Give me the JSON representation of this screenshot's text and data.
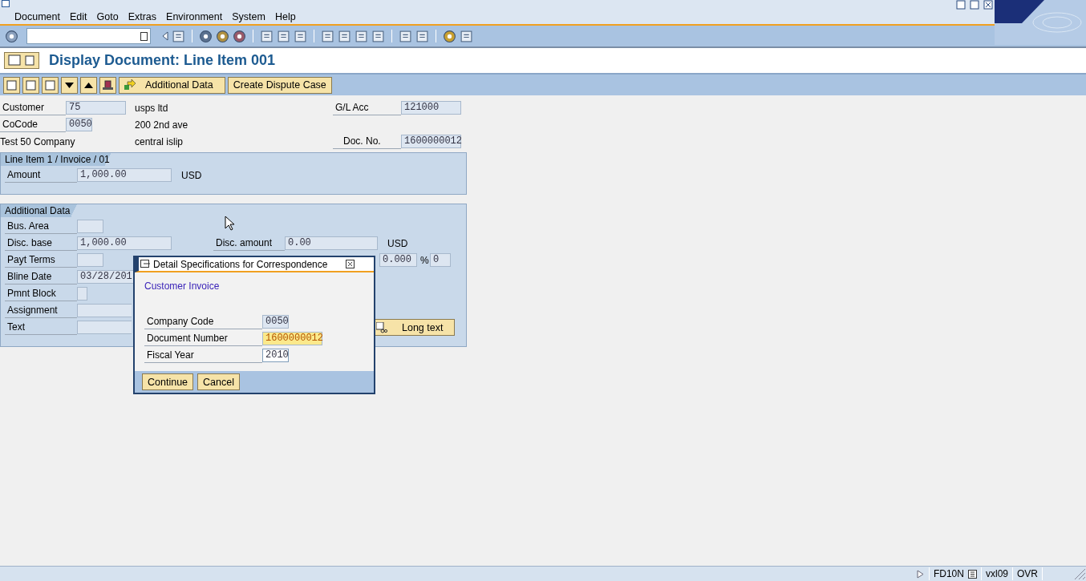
{
  "menu": [
    "Document",
    "Edit",
    "Goto",
    "Extras",
    "Environment",
    "System",
    "Help"
  ],
  "title": "Display Document: Line Item 001",
  "app_toolbar": {
    "buttons": [
      "Additional Data",
      "Create Dispute Case"
    ]
  },
  "header": {
    "customer_label": "Customer",
    "customer": "75",
    "name": "usps ltd",
    "gl_label": "G/L Acc",
    "gl": "121000",
    "cocode_label": "CoCode",
    "cocode": "0050",
    "street": "200 2nd ave",
    "company": "Test 50 Company",
    "city": "central islip",
    "docno_label": "Doc. No.",
    "docno": "1600000012"
  },
  "line_item": {
    "title": "Line Item 1 / Invoice / 01",
    "amount_label": "Amount",
    "amount": "1,000.00",
    "currency": "USD"
  },
  "additional_data": {
    "title": "Additional Data",
    "rows": [
      {
        "label": "Bus. Area",
        "value": ""
      },
      {
        "label": "Disc. base",
        "value": "1,000.00"
      },
      {
        "label": "Payt Terms",
        "value": ""
      },
      {
        "label": "Bline Date",
        "value": "03/28/201"
      },
      {
        "label": "Pmnt Block",
        "value": ""
      },
      {
        "label": "Assignment",
        "value": ""
      },
      {
        "label": "Text",
        "value": ""
      }
    ],
    "disc_amount_label": "Disc. amount",
    "disc_amount": "0.00",
    "disc_currency": "USD",
    "percent": "0.000",
    "percent_sign": "%",
    "days": "0",
    "long_text_button": "Long text"
  },
  "dialog": {
    "title": "Detail Specifications for Correspondence",
    "heading": "Customer Invoice",
    "fields": [
      {
        "label": "Company Code",
        "value": "0050",
        "kind": "display"
      },
      {
        "label": "Document Number",
        "value": "1600000012",
        "kind": "focus"
      },
      {
        "label": "Fiscal Year",
        "value": "2010",
        "kind": "input"
      }
    ],
    "buttons": [
      "Continue",
      "Cancel"
    ]
  },
  "status_bar": [
    "FD10N",
    "vxl09",
    "OVR"
  ]
}
